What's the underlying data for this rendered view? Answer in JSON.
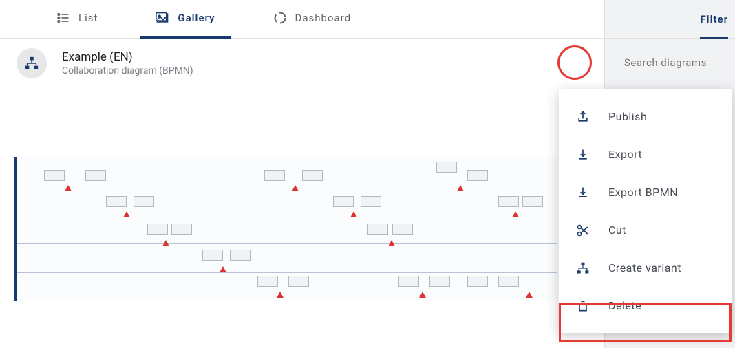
{
  "tabs": {
    "list": "List",
    "gallery": "Gallery",
    "dashboard": "Dashboard"
  },
  "header": {
    "title": "Example (EN)",
    "subtitle": "Collaboration diagram (BPMN)"
  },
  "sidepanel": {
    "filter_label": "Filter",
    "search_placeholder": "Search diagrams"
  },
  "menu": {
    "publish": "Publish",
    "export": "Export",
    "export_bpmn": "Export BPMN",
    "cut": "Cut",
    "create_variant": "Create variant",
    "delete": "Delete"
  },
  "colors": {
    "primary": "#1a3a6e",
    "highlight": "#e53935"
  }
}
